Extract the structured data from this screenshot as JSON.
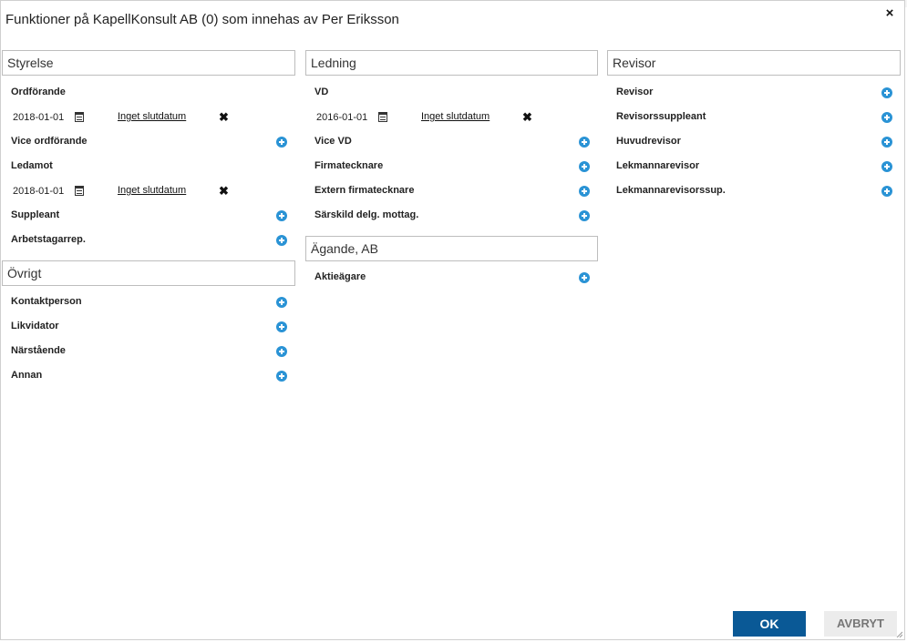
{
  "dialog": {
    "title": "Funktioner på KapellKonsult AB (0) som innehas av Per Eriksson",
    "close_label": "×"
  },
  "styrelse": {
    "header": "Styrelse",
    "ordforande": {
      "label": "Ordförande",
      "start": "2018-01-01",
      "end": "Inget slutdatum"
    },
    "vice_ordforande": "Vice ordförande",
    "ledamot": {
      "label": "Ledamot",
      "start": "2018-01-01",
      "end": "Inget slutdatum"
    },
    "suppleant": "Suppleant",
    "arbetstagarrep": "Arbetstagarrep."
  },
  "ovrigt": {
    "header": "Övrigt",
    "items": [
      "Kontaktperson",
      "Likvidator",
      "Närstående",
      "Annan"
    ]
  },
  "ledning": {
    "header": "Ledning",
    "vd": {
      "label": "VD",
      "start": "2016-01-01",
      "end": "Inget slutdatum"
    },
    "items": [
      "Vice VD",
      "Firmatecknare",
      "Extern firmatecknare",
      "Särskild delg. mottag."
    ]
  },
  "agande": {
    "header": "Ägande, AB",
    "items": [
      "Aktieägare"
    ]
  },
  "revisor": {
    "header": "Revisor",
    "items": [
      "Revisor",
      "Revisorssuppleant",
      "Huvudrevisor",
      "Lekmannarevisor",
      "Lekmannarevisorssup."
    ]
  },
  "buttons": {
    "ok": "OK",
    "cancel": "AVBRYT"
  },
  "colors": {
    "primary": "#0a5996",
    "plus_icon": "#2a93d5"
  }
}
